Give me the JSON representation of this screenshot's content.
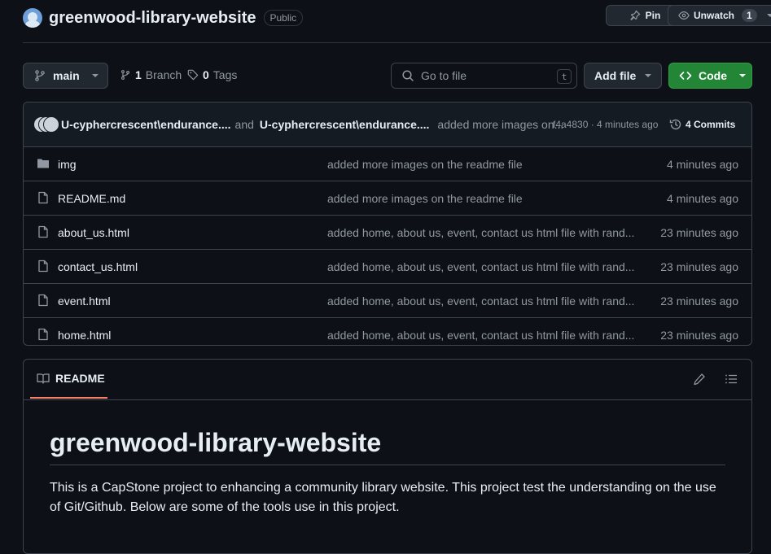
{
  "repo": {
    "name": "greenwood-library-website",
    "visibility": "Public",
    "pin_label": "Pin",
    "watch_label": "Unwatch",
    "watch_count": "1"
  },
  "toolbar": {
    "branch": "main",
    "branches_count": "1",
    "branches_label": "Branch",
    "tags_count": "0",
    "tags_label": "Tags",
    "search_placeholder": "Go to file",
    "search_shortcut": "t",
    "add_file_label": "Add file",
    "code_label": "Code"
  },
  "commit": {
    "author1": "U-cyphercrescent\\endurance....",
    "and_text": "and",
    "author2": "U-cyphercrescent\\endurance....",
    "message": "added more images on...",
    "meta": "f4a4830 · 4 minutes ago",
    "commits_label": "4 Commits"
  },
  "files": [
    {
      "name": "img",
      "type": "folder",
      "message": "added more images on the readme file",
      "time": "4 minutes ago"
    },
    {
      "name": "README.md",
      "type": "file",
      "message": "added more images on the readme file",
      "time": "4 minutes ago"
    },
    {
      "name": "about_us.html",
      "type": "file",
      "message": "added home, about us, event, contact us html file with rand...",
      "time": "23 minutes ago"
    },
    {
      "name": "contact_us.html",
      "type": "file",
      "message": "added home, about us, event, contact us html file with rand...",
      "time": "23 minutes ago"
    },
    {
      "name": "event.html",
      "type": "file",
      "message": "added home, about us, event, contact us html file with rand...",
      "time": "23 minutes ago"
    },
    {
      "name": "home.html",
      "type": "file",
      "message": "added home, about us, event, contact us html file with rand...",
      "time": "23 minutes ago"
    }
  ],
  "readme": {
    "tab_label": "README",
    "heading": "greenwood-library-website",
    "paragraph": "This is a CapStone project to enhancing a community library website. This project test the understanding on the use of Git/Github. Below are some of the tools use in this project."
  },
  "colors": {
    "background": "#0d1117",
    "border": "#3d444d",
    "accent_green": "#238636",
    "tab_underline": "#f78166"
  }
}
